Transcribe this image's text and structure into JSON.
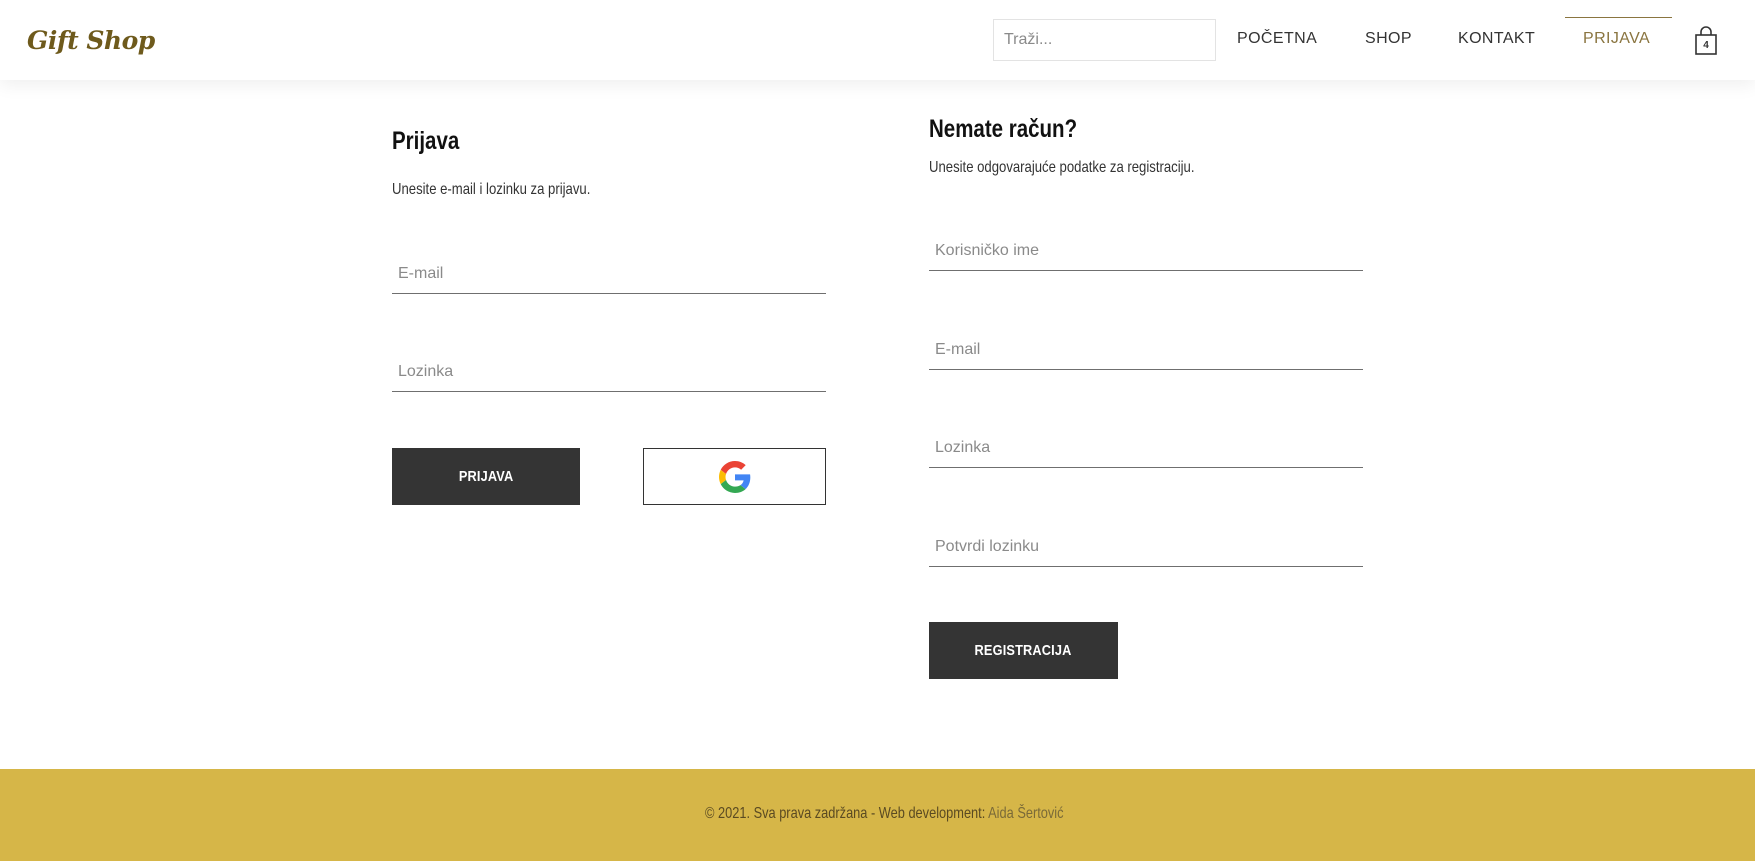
{
  "header": {
    "logo": "Gift Shop",
    "search_placeholder": "Traži...",
    "nav": [
      "POČETNA",
      "SHOP",
      "KONTAKT",
      "PRIJAVA"
    ],
    "active_nav": "PRIJAVA",
    "cart_count": "4",
    "cart_icon": "shopping-bag-icon"
  },
  "login": {
    "title": "Prijava",
    "subtitle": "Unesite e-mail i lozinku za prijavu.",
    "email_placeholder": "E-mail",
    "password_placeholder": "Lozinka",
    "submit_label": "PRIJAVA",
    "google_icon": "google-icon"
  },
  "register": {
    "title": "Nemate račun?",
    "subtitle": "Unesite odgovarajuće podatke za registraciju.",
    "username_placeholder": "Korisničko ime",
    "email_placeholder": "E-mail",
    "password_placeholder": "Lozinka",
    "confirm_placeholder": "Potvrdi lozinku",
    "submit_label": "REGISTRACIJA"
  },
  "footer": {
    "text": "© 2021. Sva prava zadržana - Web development: ",
    "author": "Aida Šertović"
  },
  "colors": {
    "accent": "#8a7540",
    "footer_bg": "#d6b648",
    "button_dark": "#343434"
  }
}
